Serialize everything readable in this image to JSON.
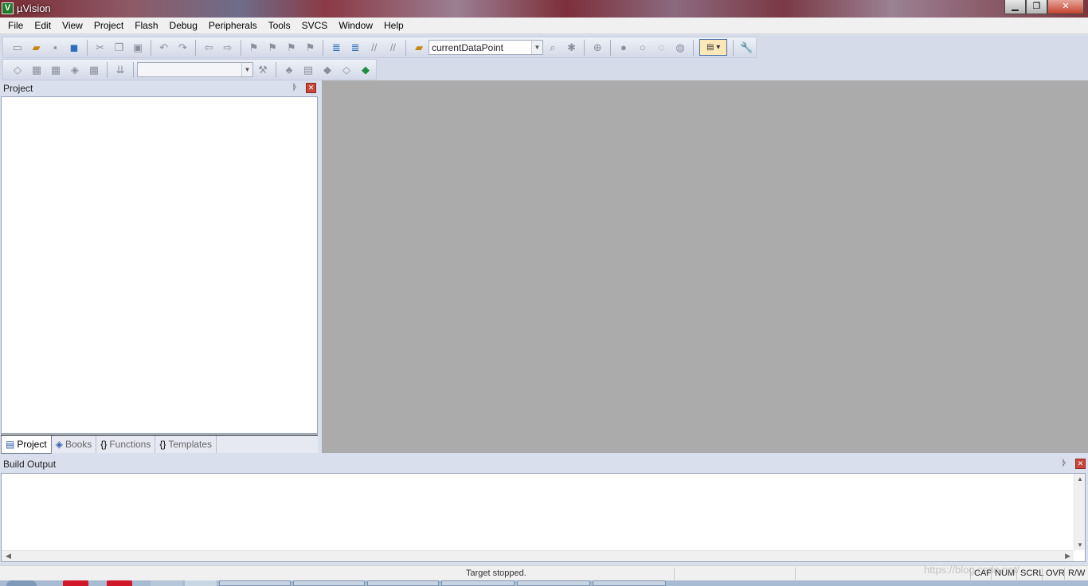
{
  "window": {
    "title": "µVision",
    "icon": "uvision-logo-icon",
    "minimize": "▁",
    "maximize": "❐",
    "close": "✕"
  },
  "menu": [
    "File",
    "Edit",
    "View",
    "Project",
    "Flash",
    "Debug",
    "Peripherals",
    "Tools",
    "SVCS",
    "Window",
    "Help"
  ],
  "toolbar": {
    "find_combo_value": "currentDataPoint",
    "target_combo_value": ""
  },
  "project_pane": {
    "title": "Project",
    "pin": "ᚦ",
    "close": "✕",
    "tabs": [
      {
        "label": "Project",
        "icon": "project-icon",
        "glyph": "▤"
      },
      {
        "label": "Books",
        "icon": "books-icon",
        "glyph": "◈"
      },
      {
        "label": "Functions",
        "icon": "functions-icon",
        "glyph": "{}"
      },
      {
        "label": "Templates",
        "icon": "templates-icon",
        "glyph": "{}"
      }
    ]
  },
  "build_output": {
    "title": "Build Output",
    "pin": "ᚦ",
    "close": "✕"
  },
  "status": {
    "message": "Target stopped.",
    "indicators": [
      "CAP",
      "NUM",
      "SCRL",
      "OVR",
      "R/W"
    ]
  },
  "watermark": "https://blog.csdn.net/...",
  "colors": {
    "editor_bg": "#ababab",
    "frame_bg": "#d9dfec",
    "close_red": "#c9463a"
  }
}
